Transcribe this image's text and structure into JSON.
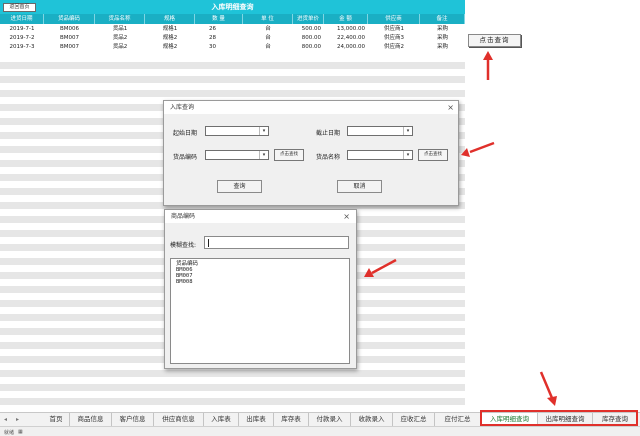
{
  "sheet": {
    "title": "入库明细查询",
    "return_label": "返回首页",
    "columns": [
      "进货日期",
      "货品编码",
      "货品名称",
      "规格",
      "数 量",
      "单 位",
      "进货单价",
      "金 额",
      "供应商",
      "备注"
    ],
    "rows": [
      [
        "2019-7-1",
        "BM006",
        "货品1",
        "规格1",
        "26",
        "台",
        "500.00",
        "13,000.00",
        "供应商1",
        "采购"
      ],
      [
        "2019-7-2",
        "BM007",
        "货品2",
        "规格2",
        "28",
        "台",
        "800.00",
        "22,400.00",
        "供应商3",
        "采购"
      ],
      [
        "2019-7-3",
        "BM007",
        "货品2",
        "规格2",
        "30",
        "台",
        "800.00",
        "24,000.00",
        "供应商2",
        "采购"
      ]
    ],
    "query_button": "点击查询"
  },
  "query_dialog": {
    "title": "入库查询",
    "close": "×",
    "start_date_label": "起始日期",
    "end_date_label": "截止日期",
    "code_label": "货品编码",
    "name_label": "货品名称",
    "search_btn": "点击查找",
    "query_btn": "查询",
    "cancel_btn": "取消",
    "arrow": "▾"
  },
  "code_dialog": {
    "title": "商品编码",
    "close": "×",
    "fuzzy_label": "模糊查找:",
    "list_items": [
      "货品编码",
      "BM006",
      "BM007",
      "BM008"
    ]
  },
  "tabs": {
    "nav_left": "◂",
    "nav_right": "▸",
    "items": [
      "首页",
      "商品信息",
      "客户信息",
      "供应商信息",
      "入库表",
      "出库表",
      "库存表",
      "付款录入",
      "收款录入",
      "应收汇总",
      "应付汇总",
      "入库明细查询",
      "出库明细查询",
      "库存查询"
    ],
    "active": "入库明细查询"
  },
  "colors": {
    "header": "#1fc3d8",
    "arrow": "#e0302b",
    "active_tab": "#1d7a33"
  },
  "status": {
    "icon_1": "就绪",
    "icon_2": "▦"
  }
}
